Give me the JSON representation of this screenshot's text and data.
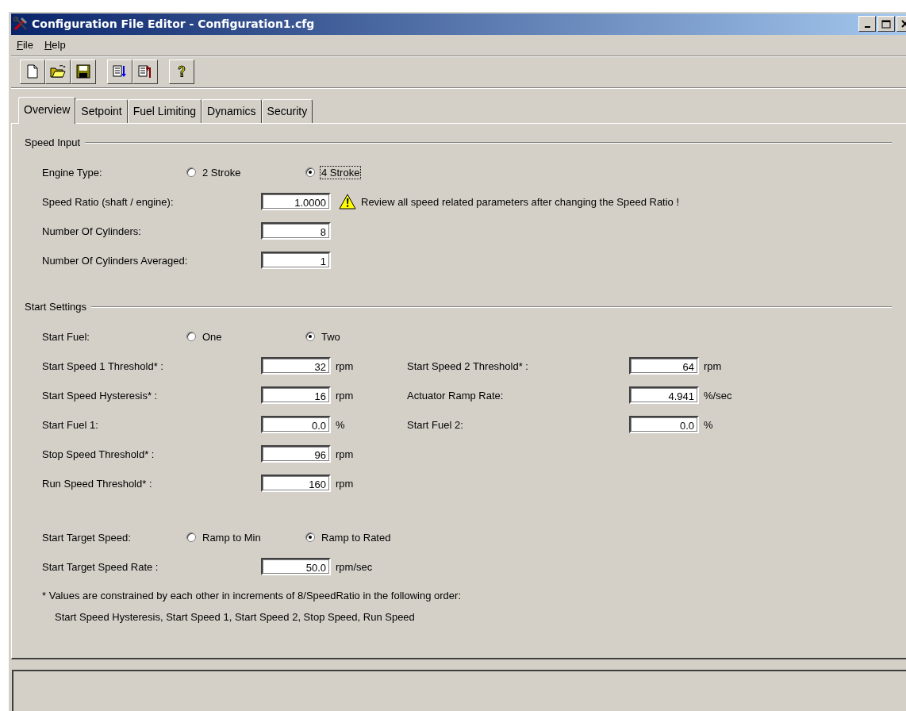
{
  "window": {
    "title": "Configuration File Editor - Configuration1.cfg"
  },
  "menu": [
    {
      "label": "File"
    },
    {
      "label": "Help"
    }
  ],
  "toolbar": [
    [
      {
        "kind": "new"
      },
      {
        "kind": "open"
      },
      {
        "kind": "save"
      }
    ],
    [
      {
        "kind": "import"
      },
      {
        "kind": "export"
      }
    ],
    [
      {
        "kind": "help"
      }
    ]
  ],
  "tabs": [
    {
      "label": "Overview",
      "selected": true
    },
    {
      "label": "Setpoint",
      "selected": false
    },
    {
      "label": "Fuel Limiting",
      "selected": false
    },
    {
      "label": "Dynamics",
      "selected": false
    },
    {
      "label": "Security",
      "selected": false
    }
  ],
  "sections": [
    {
      "title": "Speed Input",
      "groups": [
        [
          {
            "kind": "radio",
            "label": "Engine Type:",
            "options": [
              {
                "label": "2 Stroke",
                "selected": false,
                "focused": false
              },
              {
                "label": "4 Stroke",
                "selected": true,
                "focused": true
              }
            ]
          },
          {
            "kind": "field",
            "label": "Speed Ratio (shaft / engine):",
            "value": "1.0000",
            "warning": "Review all speed related parameters after changing the Speed Ratio !"
          },
          {
            "kind": "field",
            "label": "Number Of Cylinders:",
            "value": "8"
          },
          {
            "kind": "field",
            "label": "Number Of Cylinders Averaged:",
            "value": "1"
          }
        ]
      ]
    },
    {
      "title": "Start Settings",
      "groups": [
        [
          {
            "kind": "radio",
            "label": "Start Fuel:",
            "options": [
              {
                "label": "One",
                "selected": false,
                "focused": false
              },
              {
                "label": "Two",
                "selected": true,
                "focused": false
              }
            ]
          },
          {
            "kind": "field",
            "label": "Start Speed 1 Threshold* :",
            "value": "32",
            "unit": "rpm",
            "right": {
              "label": "Start Speed 2 Threshold* :",
              "value": "64",
              "unit": "rpm"
            }
          },
          {
            "kind": "field",
            "label": "Start Speed Hysteresis* :",
            "value": "16",
            "unit": "rpm",
            "right": {
              "label": "Actuator Ramp Rate:",
              "value": "4.941",
              "unit": "%/sec"
            }
          },
          {
            "kind": "field",
            "label": "Start Fuel 1:",
            "value": "0.0",
            "unit": "%",
            "right": {
              "label": "Start Fuel 2:",
              "value": "0.0",
              "unit": "%"
            }
          },
          {
            "kind": "field",
            "label": "Stop Speed Threshold* :",
            "value": "96",
            "unit": "rpm"
          },
          {
            "kind": "field",
            "label": "Run Speed Threshold* :",
            "value": "160",
            "unit": "rpm"
          }
        ],
        [
          {
            "kind": "radio",
            "label": "Start Target Speed:",
            "options": [
              {
                "label": "Ramp to Min",
                "selected": false,
                "focused": false
              },
              {
                "label": "Ramp to Rated",
                "selected": true,
                "focused": false
              }
            ]
          },
          {
            "kind": "field",
            "label": "Start Target Speed Rate :",
            "value": "50.0",
            "unit": "rpm/sec"
          }
        ]
      ],
      "notes": [
        "* Values are constrained by each other in increments of 8/SpeedRatio in the following order:",
        "Start Speed Hysteresis, Start Speed 1, Start Speed 2, Stop Speed, Run Speed"
      ]
    }
  ]
}
